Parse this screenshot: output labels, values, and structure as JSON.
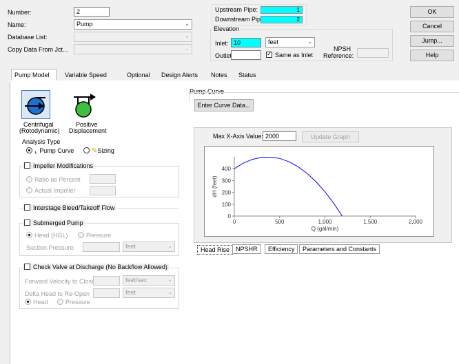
{
  "header": {
    "number_label": "Number:",
    "number_value": "2",
    "name_label": "Name:",
    "name_value": "Pump",
    "database_label": "Database List:",
    "copy_label": "Copy Data From Jct..."
  },
  "pipes": {
    "upstream_label": "Upstream Pipe:",
    "upstream_value": "1",
    "downstream_label": "Downstream Pipe:",
    "downstream_value": "2"
  },
  "elevation": {
    "title": "Elevation",
    "inlet_label": "Inlet:",
    "inlet_value": "10",
    "units": "feet",
    "outlet_label": "Outlet:",
    "same_as_inlet_label": "Same as Inlet",
    "npsh_line1": "NPSH",
    "npsh_line2": "Reference:"
  },
  "buttons": {
    "ok": "OK",
    "cancel": "Cancel",
    "jump": "Jump...",
    "help": "Help"
  },
  "tabs": [
    "Pump Model",
    "Variable Speed",
    "Optional",
    "Design Alerts",
    "Notes",
    "Status"
  ],
  "pump_types": {
    "centrifugal_line1": "Centrifugal",
    "centrifugal_line2": "(Rotodynamic)",
    "positive_line1": "Positive",
    "positive_line2": "Displacement"
  },
  "analysis": {
    "title": "Analysis Type",
    "pump_curve": "Pump Curve",
    "sizing": "Sizing"
  },
  "impeller": {
    "title": "Impeller Modifications",
    "ratio": "Ratio as Percent",
    "actual": "Actual Impeller"
  },
  "interstage": {
    "title": "Interstage Bleed/Takeoff Flow"
  },
  "submerged": {
    "title": "Submerged Pump",
    "head": "Head (HGL)",
    "pressure": "Pressure",
    "suction_label": "Suction Pressure:",
    "suction_units": "feet"
  },
  "check_valve": {
    "title": "Check Valve at Discharge (No Backflow Allowed)",
    "forward_label": "Forward Velocity to Close",
    "forward_units": "feet/sec",
    "delta_label": "Delta Head to Re-Open",
    "delta_units": "feet",
    "head": "Head",
    "pressure": "Pressure"
  },
  "pump_curve": {
    "title": "Pump Curve",
    "enter_button": "Enter Curve Data...",
    "max_x_label": "Max X-Axis Value:",
    "max_x_value": "2000",
    "update_button": "Update Graph"
  },
  "bottom_tabs": [
    "Head Rise",
    "NPSHR",
    "Efficiency",
    "Parameters and Constants"
  ],
  "chart_data": {
    "type": "line",
    "xlabel": "Q (gal/min)",
    "ylabel": "dH (feet)",
    "xlim": [
      0,
      2000
    ],
    "ylim": [
      0,
      500
    ],
    "xticks": [
      "0",
      "500",
      "1,000",
      "1,500",
      "2,000"
    ],
    "yticks": [
      "0",
      "100",
      "200",
      "300",
      "400"
    ],
    "color": "#0000ff",
    "series": [
      {
        "x": [
          0,
          100,
          200,
          300,
          400,
          500,
          600,
          700,
          800,
          900,
          1000,
          1100,
          1200,
          1250
        ],
        "values": [
          400,
          447,
          479,
          496,
          499,
          487,
          460,
          418,
          362,
          291,
          205,
          104,
          -11,
          -60
        ]
      }
    ]
  }
}
